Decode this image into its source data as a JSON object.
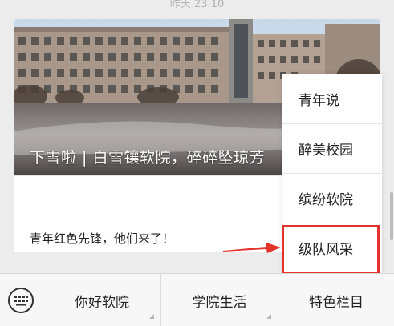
{
  "chat": {
    "timestamp": "昨天 23:10"
  },
  "article_card": {
    "cover_title": "下雪啦 | 白雪镶软院，碎碎坠琼芳",
    "sub_title": "青年红色先锋，他们来了！"
  },
  "popup_menu": {
    "items": [
      {
        "label": "青年说"
      },
      {
        "label": "醉美校园"
      },
      {
        "label": "缤纷软院"
      },
      {
        "label": "级队风采"
      }
    ],
    "highlighted_item": "级队风采",
    "highlight_color": "#e5332c"
  },
  "bottom_menu": {
    "keyboard_icon": "keyboard-icon",
    "tabs": [
      {
        "label": "你好软院"
      },
      {
        "label": "学院生活"
      },
      {
        "label": "特色栏目"
      }
    ]
  }
}
